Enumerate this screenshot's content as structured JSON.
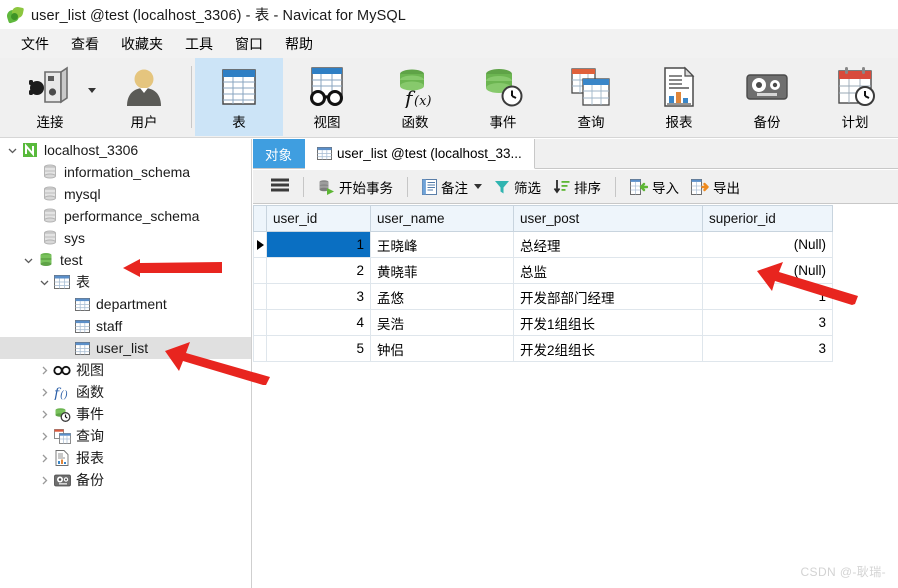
{
  "window": {
    "title": "user_list @test (localhost_3306) - 表 - Navicat for MySQL",
    "logo_icon": "navicat-logo-icon"
  },
  "menu": {
    "items": [
      {
        "label": "文件",
        "name": "menu-file"
      },
      {
        "label": "查看",
        "name": "menu-view"
      },
      {
        "label": "收藏夹",
        "name": "menu-favorites"
      },
      {
        "label": "工具",
        "name": "menu-tools"
      },
      {
        "label": "窗口",
        "name": "menu-window"
      },
      {
        "label": "帮助",
        "name": "menu-help"
      }
    ]
  },
  "ribbon": {
    "buttons": [
      {
        "label": "连接",
        "icon": "connection-icon",
        "selected": false,
        "caret": true
      },
      {
        "label": "用户",
        "icon": "user-icon",
        "selected": false,
        "caret": false
      },
      {
        "label": "表",
        "icon": "table-icon",
        "selected": true,
        "caret": false
      },
      {
        "label": "视图",
        "icon": "view-glasses-icon",
        "selected": false,
        "caret": false
      },
      {
        "label": "函数",
        "icon": "function-icon",
        "selected": false,
        "caret": false
      },
      {
        "label": "事件",
        "icon": "event-clock-icon",
        "selected": false,
        "caret": false
      },
      {
        "label": "查询",
        "icon": "query-icon",
        "selected": false,
        "caret": false
      },
      {
        "label": "报表",
        "icon": "report-icon",
        "selected": false,
        "caret": false
      },
      {
        "label": "备份",
        "icon": "backup-icon",
        "selected": false,
        "caret": false
      },
      {
        "label": "计划",
        "icon": "schedule-calendar-icon",
        "selected": false,
        "caret": false
      }
    ]
  },
  "sidebar": {
    "nodes": [
      {
        "label": "localhost_3306",
        "icon": "connection-host-icon",
        "indent": 0,
        "twisty": "down",
        "selected": false
      },
      {
        "label": "information_schema",
        "icon": "database-gray-icon",
        "indent": 1,
        "twisty": "none",
        "selected": false
      },
      {
        "label": "mysql",
        "icon": "database-gray-icon",
        "indent": 1,
        "twisty": "none",
        "selected": false
      },
      {
        "label": "performance_schema",
        "icon": "database-gray-icon",
        "indent": 1,
        "twisty": "none",
        "selected": false
      },
      {
        "label": "sys",
        "icon": "database-gray-icon",
        "indent": 1,
        "twisty": "none",
        "selected": false
      },
      {
        "label": "test",
        "icon": "database-green-icon",
        "indent": 1,
        "twisty": "down",
        "selected": false
      },
      {
        "label": "表",
        "icon": "table-folder-icon",
        "indent": 2,
        "twisty": "down",
        "selected": false
      },
      {
        "label": "department",
        "icon": "table-item-icon",
        "indent": 3,
        "twisty": "none",
        "selected": false
      },
      {
        "label": "staff",
        "icon": "table-item-icon",
        "indent": 3,
        "twisty": "none",
        "selected": false
      },
      {
        "label": "user_list",
        "icon": "table-item-icon",
        "indent": 3,
        "twisty": "none",
        "selected": true
      },
      {
        "label": "视图",
        "icon": "view-glasses-icon",
        "indent": 2,
        "twisty": "right",
        "selected": false
      },
      {
        "label": "函数",
        "icon": "function-fx-icon",
        "indent": 2,
        "twisty": "right",
        "selected": false
      },
      {
        "label": "事件",
        "icon": "event-clock-icon",
        "indent": 2,
        "twisty": "right",
        "selected": false
      },
      {
        "label": "查询",
        "icon": "query-icon",
        "indent": 2,
        "twisty": "right",
        "selected": false
      },
      {
        "label": "报表",
        "icon": "report-icon",
        "indent": 2,
        "twisty": "right",
        "selected": false
      },
      {
        "label": "备份",
        "icon": "backup-icon",
        "indent": 2,
        "twisty": "right",
        "selected": false
      }
    ]
  },
  "tabs": [
    {
      "label": "对象",
      "name": "tab-objects",
      "style": "active-blue",
      "icon": null
    },
    {
      "label": "user_list @test (localhost_33...",
      "name": "tab-user-list",
      "style": "active-white",
      "icon": "table-item-icon"
    }
  ],
  "grid_toolbar": {
    "menu_icon": "hamburger-menu-icon",
    "buttons": [
      {
        "label": "开始事务",
        "icon": "start-transaction-icon",
        "caret": false
      },
      {
        "label": "备注",
        "icon": "note-icon",
        "caret": true
      },
      {
        "label": "筛选",
        "icon": "filter-funnel-icon",
        "caret": false
      },
      {
        "label": "排序",
        "icon": "sort-icon",
        "caret": false
      },
      {
        "label": "导入",
        "icon": "import-icon",
        "caret": false
      },
      {
        "label": "导出",
        "icon": "export-icon",
        "caret": false
      }
    ]
  },
  "table": {
    "columns": [
      "user_id",
      "user_name",
      "user_post",
      "superior_id"
    ],
    "rows": [
      {
        "indicator": true,
        "user_id": "1",
        "user_name": "王晓峰",
        "user_post": "总经理",
        "superior_id": "(Null)",
        "superior_null": true,
        "selected": true
      },
      {
        "indicator": false,
        "user_id": "2",
        "user_name": "黄晓菲",
        "user_post": "总监",
        "superior_id": "(Null)",
        "superior_null": true,
        "selected": false
      },
      {
        "indicator": false,
        "user_id": "3",
        "user_name": "孟悠",
        "user_post": "开发部部门经理",
        "superior_id": "1",
        "superior_null": false,
        "selected": false
      },
      {
        "indicator": false,
        "user_id": "4",
        "user_name": "吴浩",
        "user_post": "开发1组组长",
        "superior_id": "3",
        "superior_null": false,
        "selected": false
      },
      {
        "indicator": false,
        "user_id": "5",
        "user_name": "钟侣",
        "user_post": "开发2组组长",
        "superior_id": "3",
        "superior_null": false,
        "selected": false
      }
    ]
  },
  "annotations": {
    "arrow_color": "#e8251f",
    "arrows": [
      {
        "name": "arrow-to-test-node"
      },
      {
        "name": "arrow-to-user-list-node"
      },
      {
        "name": "arrow-to-null-values"
      }
    ]
  },
  "watermark": {
    "text": "CSDN @-耿瑞-"
  },
  "colors": {
    "accent_blue": "#3f9ee0",
    "selection_blue": "#0a6fc2",
    "ribbon_selected": "#cce4f7",
    "header_blue": "#eef5fb",
    "arrow_red": "#e8251f"
  }
}
